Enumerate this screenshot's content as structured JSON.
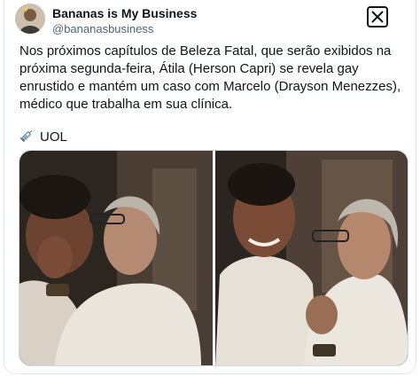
{
  "tweet": {
    "author_name": "Bananas is My Business",
    "author_handle": "@bananasbusiness",
    "text": "Nos próximos capítulos de Beleza Fatal, que serão exibidos na próxima segunda-feira, Átila (Herson Capri) se revela gay enrustido e mantém um caso com Marcelo (Drayson Menezzes), médico que trabalha em sua clínica.",
    "source_label": "UOL",
    "source_icon": "syringe-icon",
    "overlay_logo": "x-logo-icon"
  },
  "colors": {
    "text": "#0f1419",
    "secondary": "#536471",
    "border": "#cfd9de"
  }
}
